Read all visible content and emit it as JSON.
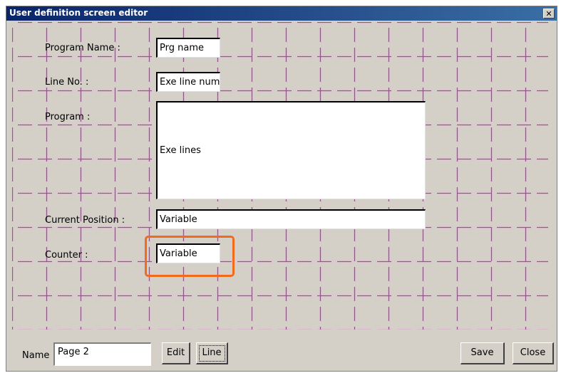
{
  "window": {
    "title": "User definition screen editor",
    "close_glyph": "✕"
  },
  "canvas": {
    "labels": {
      "program_name": "Program Name :",
      "line_no": "Line No. :",
      "program": "Program :",
      "current_position": "Current Position :",
      "counter": "Counter :"
    },
    "fields": {
      "program_name": "Prg name",
      "line_no": "Exe line num",
      "program": "Exe lines",
      "current_position": "Variable",
      "counter": "Variable"
    },
    "grid_color": "#e020e0",
    "highlight_color": "#f26a1b"
  },
  "bottom": {
    "name_label": "Name",
    "name_value": "Page 2",
    "edit_label": "Edit",
    "line_label": "Line",
    "save_label": "Save",
    "close_label": "Close"
  }
}
